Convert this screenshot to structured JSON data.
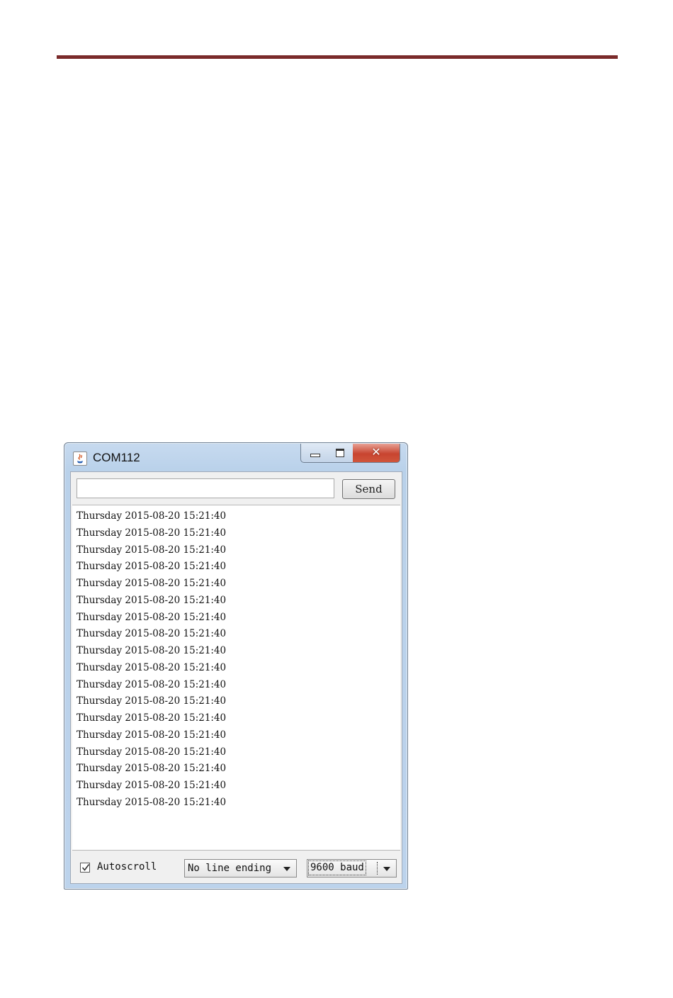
{
  "window": {
    "title": "COM112",
    "controls": {
      "minimize": "minimize",
      "maximize": "maximize",
      "close": "close"
    }
  },
  "input": {
    "value": "",
    "placeholder": ""
  },
  "send_button": {
    "label": "Send"
  },
  "output_lines": [
    "Thursday 2015-08-20 15:21:40",
    "Thursday 2015-08-20 15:21:40",
    "Thursday 2015-08-20 15:21:40",
    "Thursday 2015-08-20 15:21:40",
    "Thursday 2015-08-20 15:21:40",
    "Thursday 2015-08-20 15:21:40",
    "Thursday 2015-08-20 15:21:40",
    "Thursday 2015-08-20 15:21:40",
    "Thursday 2015-08-20 15:21:40",
    "Thursday 2015-08-20 15:21:40",
    "Thursday 2015-08-20 15:21:40",
    "Thursday 2015-08-20 15:21:40",
    "Thursday 2015-08-20 15:21:40",
    "Thursday 2015-08-20 15:21:40",
    "Thursday 2015-08-20 15:21:40",
    "Thursday 2015-08-20 15:21:40",
    "Thursday 2015-08-20 15:21:40",
    "Thursday 2015-08-20 15:21:40"
  ],
  "footer": {
    "autoscroll": {
      "label": "Autoscroll",
      "checked": true
    },
    "line_ending": {
      "selected": "No line ending"
    },
    "baud": {
      "selected": "9600 baud"
    }
  },
  "colors": {
    "page_rule": "#7a2a2a",
    "close_button": "#c8442f",
    "window_frame": "#b9d1ea"
  },
  "icons": {
    "app": "java-app-icon",
    "minimize": "minimize-icon",
    "maximize": "maximize-icon",
    "close": "close-icon",
    "checkbox": "checkmark-icon",
    "dropdown": "chevron-down-icon"
  }
}
